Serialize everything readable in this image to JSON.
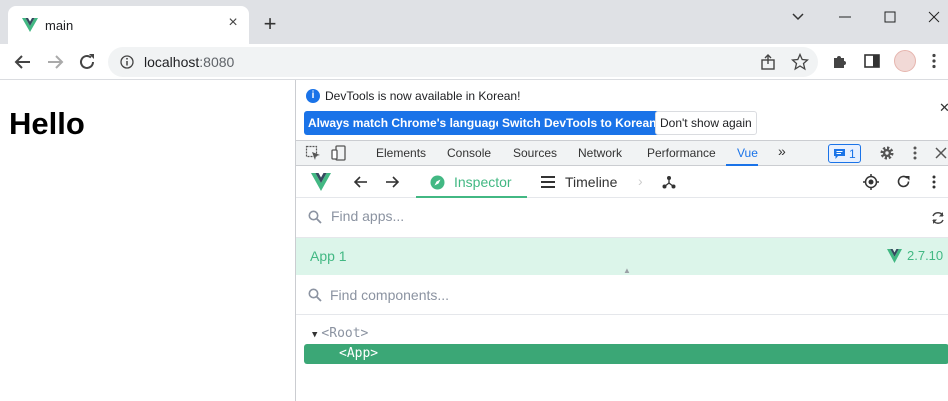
{
  "browser": {
    "tab_title": "main",
    "url_host": "localhost",
    "url_port": ":8080"
  },
  "page": {
    "heading": "Hello"
  },
  "devtools": {
    "infobar": {
      "message": "DevTools is now available in Korean!",
      "btn_match": "Always match Chrome's language",
      "btn_switch": "Switch DevTools to Korean",
      "btn_dont_show": "Don't show again"
    },
    "tabs": [
      "Elements",
      "Console",
      "Sources",
      "Network",
      "Performance",
      "Vue"
    ],
    "issues_count": "1",
    "vue": {
      "inspector_label": "Inspector",
      "timeline_label": "Timeline",
      "apps_search_placeholder": "Find apps...",
      "app_name": "App 1",
      "vue_version": "2.7.10",
      "components_search_placeholder": "Find components...",
      "tree_root": "<Root>",
      "tree_app": "<App>"
    }
  },
  "colors": {
    "vue_green": "#42b883",
    "chrome_blue": "#1a73e8"
  }
}
